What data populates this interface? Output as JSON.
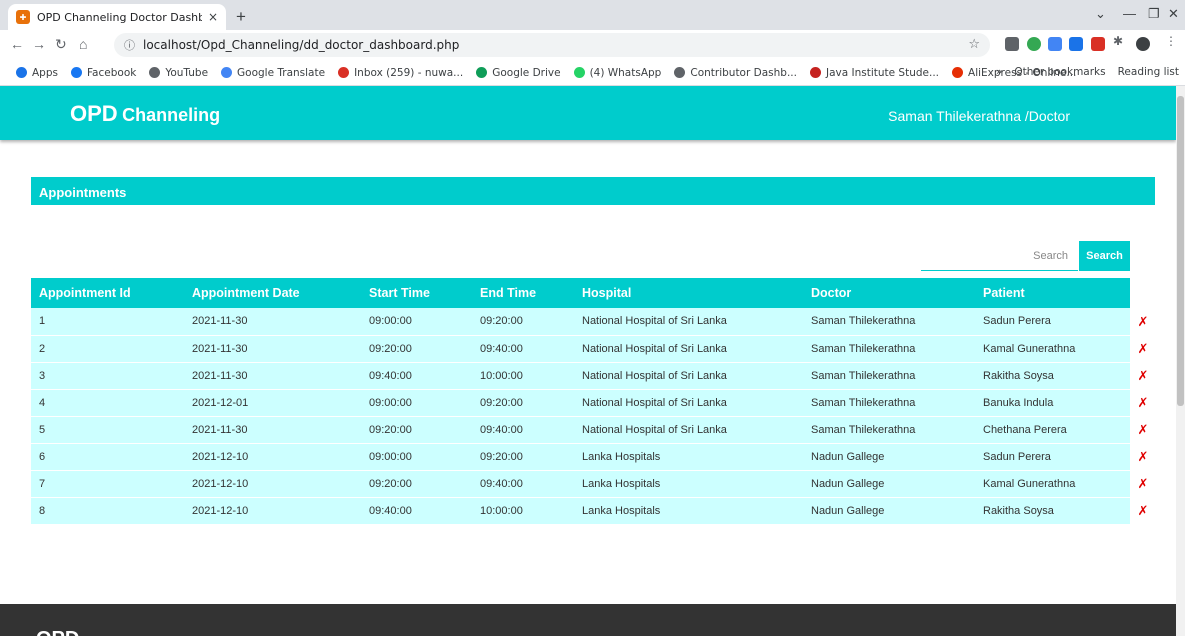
{
  "browser": {
    "tab_title": "OPD Channeling Doctor Dashbo",
    "tab_close": "×",
    "new_tab": "+",
    "url": "localhost/Opd_Channeling/dd_doctor_dashboard.php",
    "bookmarks": [
      {
        "label": "Apps",
        "color": "#1a73e8"
      },
      {
        "label": "Facebook",
        "color": "#1877f2"
      },
      {
        "label": "YouTube",
        "color": "#5f6368"
      },
      {
        "label": "Google Translate",
        "color": "#4285f4"
      },
      {
        "label": "Inbox (259) - nuwa...",
        "color": "#d93025"
      },
      {
        "label": "Google Drive",
        "color": "#0f9d58"
      },
      {
        "label": "(4) WhatsApp",
        "color": "#25d366"
      },
      {
        "label": "Contributor Dashb...",
        "color": "#5f6368"
      },
      {
        "label": "Java Institute Stude...",
        "color": "#c5221f"
      },
      {
        "label": "AliExpress - Online...",
        "color": "#e62e04"
      }
    ],
    "bookmarks_more": "»",
    "other_bookmarks": "Other bookmarks",
    "reading_list": "Reading list"
  },
  "header": {
    "brand_big": "OPD",
    "brand_small": "Channeling",
    "user": "Saman Thilekerathna /Doctor"
  },
  "section_title": "Appointments",
  "search": {
    "placeholder": "Search",
    "button": "Search"
  },
  "table": {
    "columns": [
      "Appointment Id",
      "Appointment Date",
      "Start Time",
      "End Time",
      "Hospital",
      "Doctor",
      "Patient"
    ],
    "rows": [
      [
        "1",
        "2021-11-30",
        "09:00:00",
        "09:20:00",
        "National Hospital of Sri Lanka",
        "Saman Thilekerathna",
        "Sadun Perera"
      ],
      [
        "2",
        "2021-11-30",
        "09:20:00",
        "09:40:00",
        "National Hospital of Sri Lanka",
        "Saman Thilekerathna",
        "Kamal Gunerathna"
      ],
      [
        "3",
        "2021-11-30",
        "09:40:00",
        "10:00:00",
        "National Hospital of Sri Lanka",
        "Saman Thilekerathna",
        "Rakitha Soysa"
      ],
      [
        "4",
        "2021-12-01",
        "09:00:00",
        "09:20:00",
        "National Hospital of Sri Lanka",
        "Saman Thilekerathna",
        "Banuka Indula"
      ],
      [
        "5",
        "2021-11-30",
        "09:20:00",
        "09:40:00",
        "National Hospital of Sri Lanka",
        "Saman Thilekerathna",
        "Chethana Perera"
      ],
      [
        "6",
        "2021-12-10",
        "09:00:00",
        "09:20:00",
        "Lanka Hospitals",
        "Nadun Gallege",
        "Sadun Perera"
      ],
      [
        "7",
        "2021-12-10",
        "09:20:00",
        "09:40:00",
        "Lanka Hospitals",
        "Nadun Gallege",
        "Kamal Gunerathna"
      ],
      [
        "8",
        "2021-12-10",
        "09:40:00",
        "10:00:00",
        "Lanka Hospitals",
        "Nadun Gallege",
        "Rakitha Soysa"
      ]
    ],
    "delete_glyph": "✗"
  },
  "footer": {
    "logo": "OPD"
  },
  "colors": {
    "accent": "#00cccc",
    "row_bg": "#ccffff",
    "delete": "#e00000",
    "footer": "#333333"
  }
}
